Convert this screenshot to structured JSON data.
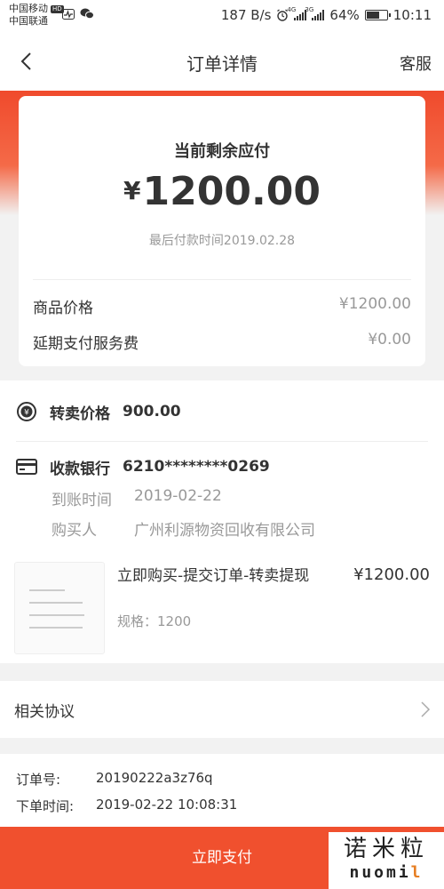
{
  "status_bar": {
    "carrier1": "中国移动",
    "carrier1_badge": "HD",
    "carrier2": "中国联通",
    "speed": "187 B/s",
    "net1": "4G",
    "net2": "3G",
    "battery": "64%",
    "battery_level": 0.64,
    "time": "10:11"
  },
  "nav": {
    "title": "订单详情",
    "service": "客服"
  },
  "payment": {
    "remain_label": "当前剩余应付",
    "currency": "¥",
    "amount": "1200.00",
    "deadline": "最后付款时间2019.02.28",
    "rows": [
      {
        "label": "商品价格",
        "value": "¥1200.00"
      },
      {
        "label": "延期支付服务费",
        "value": "¥0.00"
      }
    ]
  },
  "resale": {
    "label": "转卖价格",
    "value": "900.00"
  },
  "bank": {
    "label": "收款银行",
    "value": "6210********0269",
    "arrival_label": "到账时间",
    "arrival_value": "2019-02-22",
    "buyer_label": "购买人",
    "buyer_value": "广州利源物资回收有限公司"
  },
  "product": {
    "name": "立即购买-提交订单-转卖提现",
    "spec": "规格：1200",
    "price": "¥1200.00"
  },
  "agreement": {
    "label": "相关协议"
  },
  "order": {
    "number_label": "订单号:",
    "number_value": "20190222a3z76q",
    "time_label": "下单时间:",
    "time_value": "2019-02-22 10:08:31"
  },
  "pay_button": "立即支付",
  "watermark": {
    "cn": "诺米粒",
    "en_main": "nuomi",
    "en_tail": "l"
  },
  "colors": {
    "accent": "#f0502e",
    "muted_text": "#999999",
    "primary_text": "#333333"
  }
}
